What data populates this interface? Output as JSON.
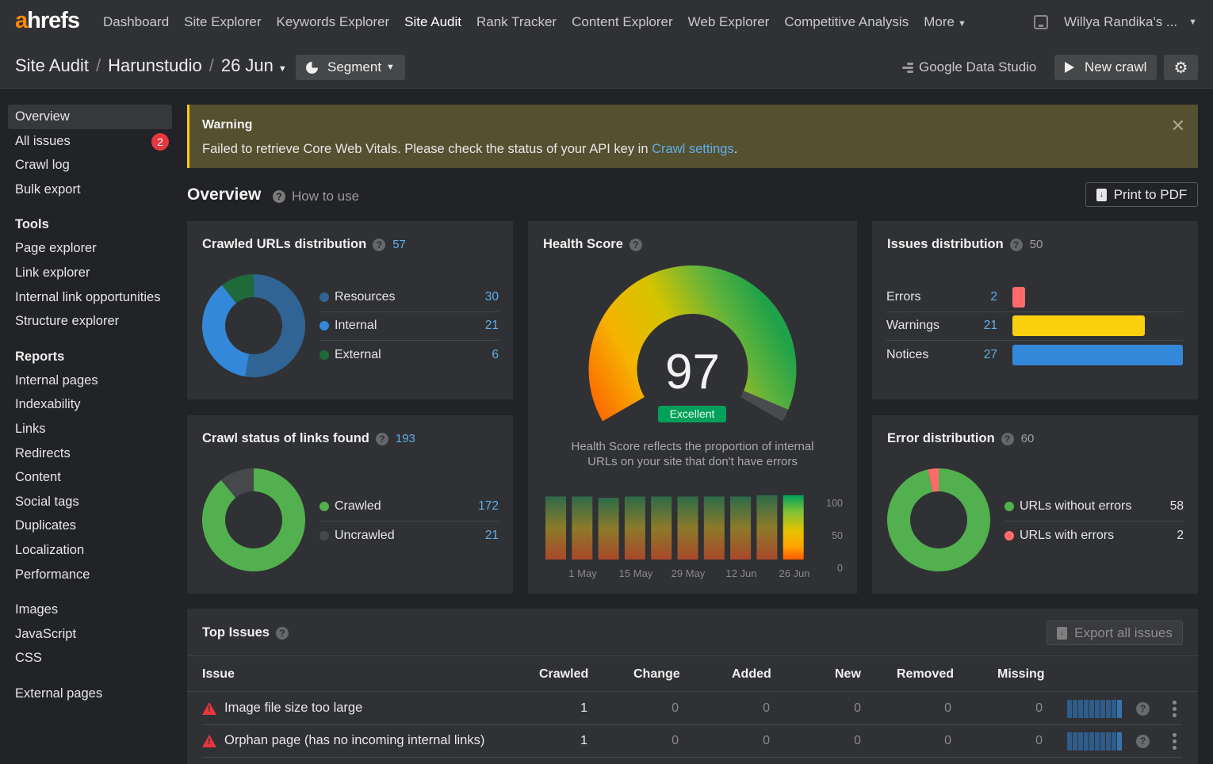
{
  "app": {
    "logo_accent": "a",
    "logo_rest": "hrefs"
  },
  "nav": {
    "items": [
      {
        "label": "Dashboard",
        "active": false
      },
      {
        "label": "Site Explorer",
        "active": false
      },
      {
        "label": "Keywords Explorer",
        "active": false
      },
      {
        "label": "Site Audit",
        "active": true
      },
      {
        "label": "Rank Tracker",
        "active": false
      },
      {
        "label": "Content Explorer",
        "active": false
      },
      {
        "label": "Web Explorer",
        "active": false
      },
      {
        "label": "Competitive Analysis",
        "active": false
      },
      {
        "label": "More",
        "active": false,
        "dropdown": true
      }
    ],
    "account": "Willya Randika's ..."
  },
  "breadcrumb": {
    "root": "Site Audit",
    "project": "Harunstudio",
    "date": "26 Jun"
  },
  "toolbar": {
    "segment": "Segment",
    "google_data_studio": "Google Data Studio",
    "new_crawl": "New crawl"
  },
  "sidebar": {
    "main": [
      {
        "label": "Overview",
        "active": true
      },
      {
        "label": "All issues",
        "badge": "2"
      },
      {
        "label": "Crawl log"
      },
      {
        "label": "Bulk export"
      }
    ],
    "tools_heading": "Tools",
    "tools": [
      "Page explorer",
      "Link explorer",
      "Internal link opportunities",
      "Structure explorer"
    ],
    "reports_heading": "Reports",
    "reports": [
      "Internal pages",
      "Indexability",
      "Links",
      "Redirects",
      "Content",
      "Social tags",
      "Duplicates",
      "Localization",
      "Performance"
    ],
    "extra": [
      "Images",
      "JavaScript",
      "CSS"
    ],
    "external": [
      "External pages"
    ]
  },
  "warning": {
    "title": "Warning",
    "message": "Failed to retrieve Core Web Vitals. Please check the status of your API key in ",
    "link": "Crawl settings",
    "suffix": "."
  },
  "overview": {
    "title": "Overview",
    "how_to_use": "How to use",
    "print": "Print to PDF"
  },
  "crawled_urls": {
    "title": "Crawled URLs distribution",
    "total": "57",
    "items": [
      {
        "label": "Resources",
        "value": 30,
        "color": "#2f6495"
      },
      {
        "label": "Internal",
        "value": 21,
        "color": "#3388d9"
      },
      {
        "label": "External",
        "value": 6,
        "color": "#1e6a3a"
      }
    ]
  },
  "crawl_status": {
    "title": "Crawl status of links found",
    "total": "193",
    "items": [
      {
        "label": "Crawled",
        "value": 172,
        "color": "#52b04f"
      },
      {
        "label": "Uncrawled",
        "value": 21,
        "color": "#47484b"
      }
    ]
  },
  "health": {
    "title": "Health Score",
    "score": 97,
    "rating": "Excellent",
    "description_line1": "Health Score reflects the proportion of internal",
    "description_line2": "URLs on your site that don't have errors",
    "history": [
      97,
      97,
      95,
      97,
      97,
      97,
      97,
      97,
      99,
      99
    ],
    "x_labels": [
      "1 May",
      "15 May",
      "29 May",
      "12 Jun",
      "26 Jun"
    ],
    "y_labels": [
      "100",
      "50",
      "0"
    ]
  },
  "issues_dist": {
    "title": "Issues distribution",
    "total": "50",
    "items": [
      {
        "label": "Errors",
        "value": 2,
        "color": "#ff6b6b"
      },
      {
        "label": "Warnings",
        "value": 21,
        "color": "#f9cf0e"
      },
      {
        "label": "Notices",
        "value": 27,
        "color": "#3388d9"
      }
    ]
  },
  "error_dist": {
    "title": "Error distribution",
    "total": "60",
    "items": [
      {
        "label": "URLs without errors",
        "value": 58,
        "color": "#52b04f"
      },
      {
        "label": "URLs with errors",
        "value": 2,
        "color": "#ff6b6b"
      }
    ]
  },
  "top_issues": {
    "title": "Top Issues",
    "export": "Export all issues",
    "columns": [
      "Issue",
      "Crawled",
      "Change",
      "Added",
      "New",
      "Removed",
      "Missing"
    ],
    "rows": [
      {
        "issue": "Image file size too large",
        "crawled": "1",
        "change": "0",
        "added": "0",
        "new": "0",
        "removed": "0",
        "missing": "0"
      },
      {
        "issue": "Orphan page (has no incoming internal links)",
        "crawled": "1",
        "change": "0",
        "added": "0",
        "new": "0",
        "removed": "0",
        "missing": "0"
      }
    ]
  },
  "chart_data": [
    {
      "type": "pie",
      "title": "Crawled URLs distribution",
      "categories": [
        "Resources",
        "Internal",
        "External"
      ],
      "values": [
        30,
        21,
        6
      ]
    },
    {
      "type": "pie",
      "title": "Crawl status of links found",
      "categories": [
        "Crawled",
        "Uncrawled"
      ],
      "values": [
        172,
        21
      ]
    },
    {
      "type": "bar",
      "title": "Health Score history",
      "categories": [
        "",
        "1 May",
        "",
        "15 May",
        "",
        "29 May",
        "",
        "12 Jun",
        "",
        "26 Jun"
      ],
      "values": [
        97,
        97,
        95,
        97,
        97,
        97,
        97,
        97,
        99,
        99
      ],
      "ylim": [
        0,
        100
      ],
      "x_tick_labels": [
        "1 May",
        "15 May",
        "29 May",
        "12 Jun",
        "26 Jun"
      ],
      "y_tick_labels": [
        "0",
        "50",
        "100"
      ]
    },
    {
      "type": "bar",
      "title": "Issues distribution",
      "categories": [
        "Errors",
        "Warnings",
        "Notices"
      ],
      "values": [
        2,
        21,
        27
      ]
    },
    {
      "type": "pie",
      "title": "Error distribution",
      "categories": [
        "URLs without errors",
        "URLs with errors"
      ],
      "values": [
        58,
        2
      ]
    }
  ]
}
